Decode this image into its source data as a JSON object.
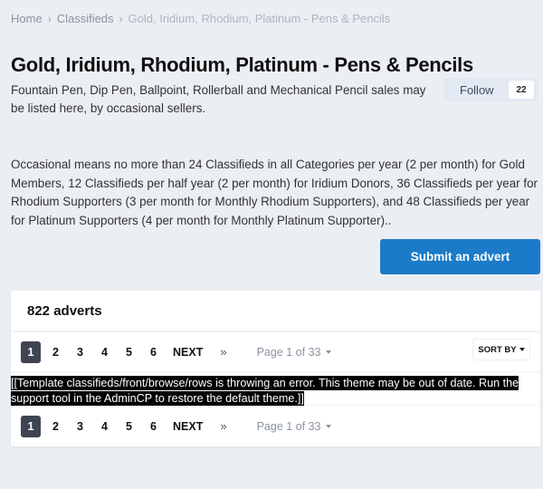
{
  "breadcrumb": {
    "items": [
      "Home",
      "Classifieds"
    ],
    "current": "Gold, Iridium, Rhodium, Platinum - Pens & Pencils",
    "separator": "›"
  },
  "header": {
    "title": "Gold, Iridium, Rhodium, Platinum - Pens & Pencils",
    "description": "Fountain Pen, Dip Pen, Ballpoint, Rollerball and Mechanical Pencil sales may be listed here, by occasional sellers.",
    "follow_label": "Follow",
    "follow_count": "22"
  },
  "rules_text": "Occasional means no more than 24 Classifieds in all Categories per year (2 per month) for Gold Members, 12 Classifieds per half year (2 per month) for Iridium Donors, 36 Classifieds per year for Rhodium Supporters (3 per month for Monthly Rhodium Supporters), and 48 Classifieds per year for Platinum Supporters (4 per month for Monthly Platinum Supporter)..",
  "submit_label": "Submit an advert",
  "listing": {
    "count_label": "822 adverts",
    "pagination": {
      "pages": [
        "1",
        "2",
        "3",
        "4",
        "5",
        "6"
      ],
      "current_page": "1",
      "next_label": "NEXT",
      "last_label": "»",
      "page_info": "Page 1 of 33"
    },
    "sort_label": "SORT BY",
    "error_message": "[[Template classifieds/front/browse/rows is throwing an error. This theme may be out of date. Run the support tool in the AdminCP to restore the default theme.]]"
  },
  "colors": {
    "accent": "#1b7bc9",
    "background": "#ebeef3",
    "active_page": "#3e4450"
  }
}
